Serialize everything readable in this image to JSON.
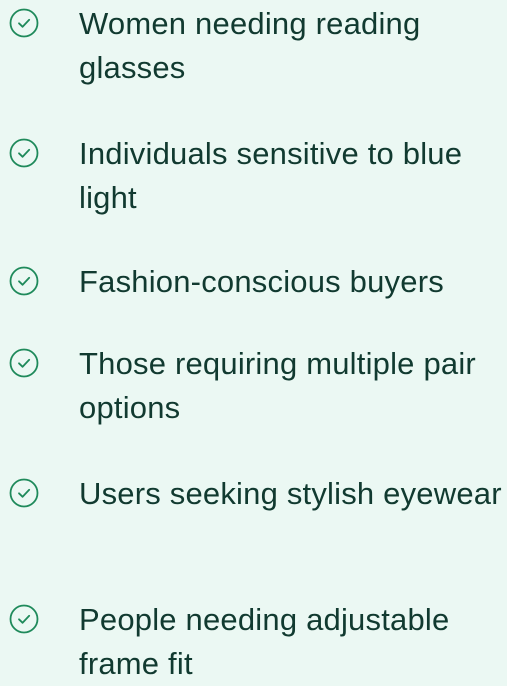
{
  "accent_color": "#1f8a5b",
  "text_color": "#113a30",
  "background_color": "#ebf8f3",
  "items": [
    {
      "icon": "check-circle-icon",
      "label": "Women needing reading glasses"
    },
    {
      "icon": "check-circle-icon",
      "label": "Individuals sensitive to blue light"
    },
    {
      "icon": "check-circle-icon",
      "label": "Fashion-conscious buyers"
    },
    {
      "icon": "check-circle-icon",
      "label": "Those requiring multiple pair options"
    },
    {
      "icon": "check-circle-icon",
      "label": "Users seeking stylish eyewear"
    },
    {
      "icon": "check-circle-icon",
      "label": "People needing adjustable frame fit"
    }
  ]
}
